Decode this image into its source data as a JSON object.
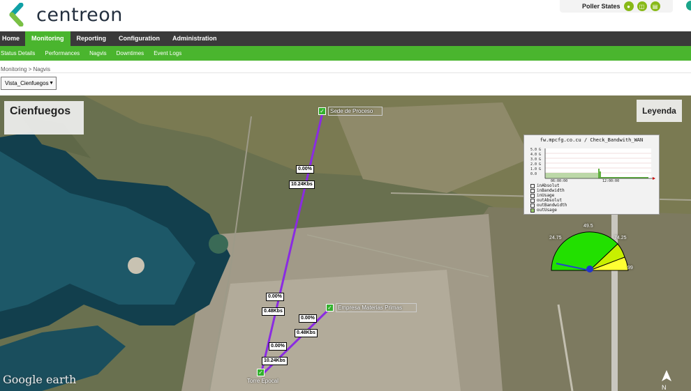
{
  "app": {
    "name": "centreon"
  },
  "header": {
    "poller_label": "Poller States",
    "poller_icons": [
      "poller-status-icon",
      "database-icon",
      "server-icon"
    ]
  },
  "nav": {
    "main": [
      "Home",
      "Monitoring",
      "Reporting",
      "Configuration",
      "Administration"
    ],
    "active": "Monitoring",
    "sub": [
      "Status Details",
      "Performances",
      "Nagvis",
      "Downtimes",
      "Event Logs"
    ]
  },
  "breadcrumb": {
    "root": "Monitoring",
    "sep": ">",
    "current": "Nagvis"
  },
  "view_select": {
    "value": "Vista_Cienfuegos"
  },
  "map": {
    "title": "Cienfuegos",
    "legend_label": "Leyenda",
    "watermark": "Google earth",
    "compass": "N",
    "nodes": [
      {
        "label": "Sede de Proceso"
      },
      {
        "label": "Empresa Materias Primas"
      },
      {
        "label": "Torre Epocal"
      }
    ],
    "links": [
      {
        "usage": "0.00%",
        "bandwidth": "10.24Kbs"
      },
      {
        "usage": "0.00%",
        "bandwidth": "0.48Kbs"
      },
      {
        "usage": "0.00%",
        "bandwidth": "0.48Kbs"
      },
      {
        "usage": "0.00%",
        "bandwidth": "10.24Kbs"
      }
    ],
    "graph": {
      "title": "fw.mpcfg.co.cu / Check_Bandwith_WAN",
      "yticks": [
        "5.0 G",
        "4.0 G",
        "3.0 G",
        "2.0 G",
        "1.0 G",
        "0.0"
      ],
      "xticks": [
        "06:00:00",
        "12:00:00"
      ],
      "legend": [
        "inAbsolut",
        "inBandwidth",
        "inUsage",
        "outAbsolut",
        "outBandwidth",
        "outUsage"
      ]
    },
    "gauge": {
      "top": "49.5",
      "left": "24.75",
      "right": "74.25",
      "max": "99"
    }
  },
  "colors": {
    "brand_green": "#4ab52e",
    "nav_dark": "#3a3a3a",
    "link_purple": "#8a2be2"
  }
}
